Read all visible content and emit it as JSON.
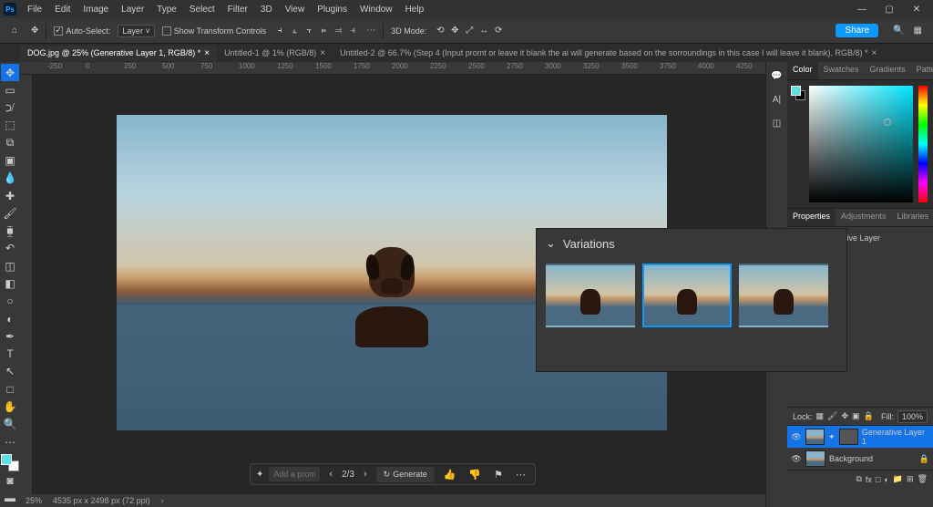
{
  "app": {
    "name": "Ps"
  },
  "menu": [
    "File",
    "Edit",
    "Image",
    "Layer",
    "Type",
    "Select",
    "Filter",
    "3D",
    "View",
    "Plugins",
    "Window",
    "Help"
  ],
  "options": {
    "auto_select": "Auto-Select:",
    "auto_select_mode": "Layer",
    "show_transform": "Show Transform Controls",
    "mode_3d": "3D Mode:"
  },
  "share": "Share",
  "tabs": [
    {
      "label": "DOG.jpg @ 25% (Generative Layer 1, RGB/8) *",
      "active": true
    },
    {
      "label": "Untitled-1 @ 1% (RGB/8)",
      "active": false
    },
    {
      "label": "Untitled-2 @ 66.7% (Step 4 (Input promt or leave it blank the ai will generate based on the sorroundings in this case I will leave it blank), RGB/8) *",
      "active": false
    }
  ],
  "ruler_marks": [
    "-250",
    "0",
    "250",
    "500",
    "750",
    "1000",
    "1250",
    "1500",
    "1750",
    "2000",
    "2250",
    "2500",
    "2750",
    "3000",
    "3250",
    "3500",
    "3750",
    "4000",
    "4250"
  ],
  "taskbar": {
    "prompt_placeholder": "Add a prompt...",
    "counter": "2/3",
    "generate": "Generate"
  },
  "status": {
    "zoom": "25%",
    "dims": "4535 px x 2498 px (72 ppi)"
  },
  "panels": {
    "color_tabs": [
      "Color",
      "Swatches",
      "Gradients",
      "Patterns"
    ],
    "prop_tabs": [
      "Properties",
      "Adjustments",
      "Libraries"
    ],
    "prop_kind": "Generative Layer",
    "layers_lock": "Lock:",
    "fill": "Fill:",
    "fill_val": "100%",
    "layers": [
      {
        "name": "Generative Layer 1",
        "selected": true,
        "locked": false
      },
      {
        "name": "Background",
        "selected": false,
        "locked": true
      }
    ]
  },
  "variations": {
    "title": "Variations",
    "selected": 1
  }
}
